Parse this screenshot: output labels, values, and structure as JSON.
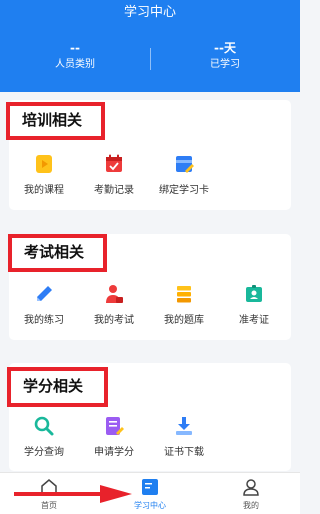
{
  "header": {
    "title": "学习中心",
    "stats": [
      {
        "value": "--",
        "label": "人员类别"
      },
      {
        "value": "--天",
        "label": "已学习"
      }
    ]
  },
  "sections": [
    {
      "title": "培训相关",
      "items": [
        {
          "label": "我的课程",
          "icon": "video-icon"
        },
        {
          "label": "考勤记录",
          "icon": "calendar-icon"
        },
        {
          "label": "绑定学习卡",
          "icon": "card-icon"
        }
      ]
    },
    {
      "title": "考试相关",
      "items": [
        {
          "label": "我的练习",
          "icon": "pencil-icon"
        },
        {
          "label": "我的考试",
          "icon": "exam-icon"
        },
        {
          "label": "我的题库",
          "icon": "database-icon"
        },
        {
          "label": "准考证",
          "icon": "id-card-icon"
        }
      ]
    },
    {
      "title": "学分相关",
      "items": [
        {
          "label": "学分查询",
          "icon": "search-icon"
        },
        {
          "label": "申请学分",
          "icon": "form-icon"
        },
        {
          "label": "证书下载",
          "icon": "download-icon"
        }
      ]
    }
  ],
  "tabbar": [
    {
      "label": "首页",
      "icon": "home-icon"
    },
    {
      "label": "学习中心",
      "icon": "book-icon",
      "active": true
    },
    {
      "label": "我的",
      "icon": "user-icon"
    }
  ],
  "colors": {
    "primary": "#1f7ff0",
    "highlight": "#e8222b"
  }
}
